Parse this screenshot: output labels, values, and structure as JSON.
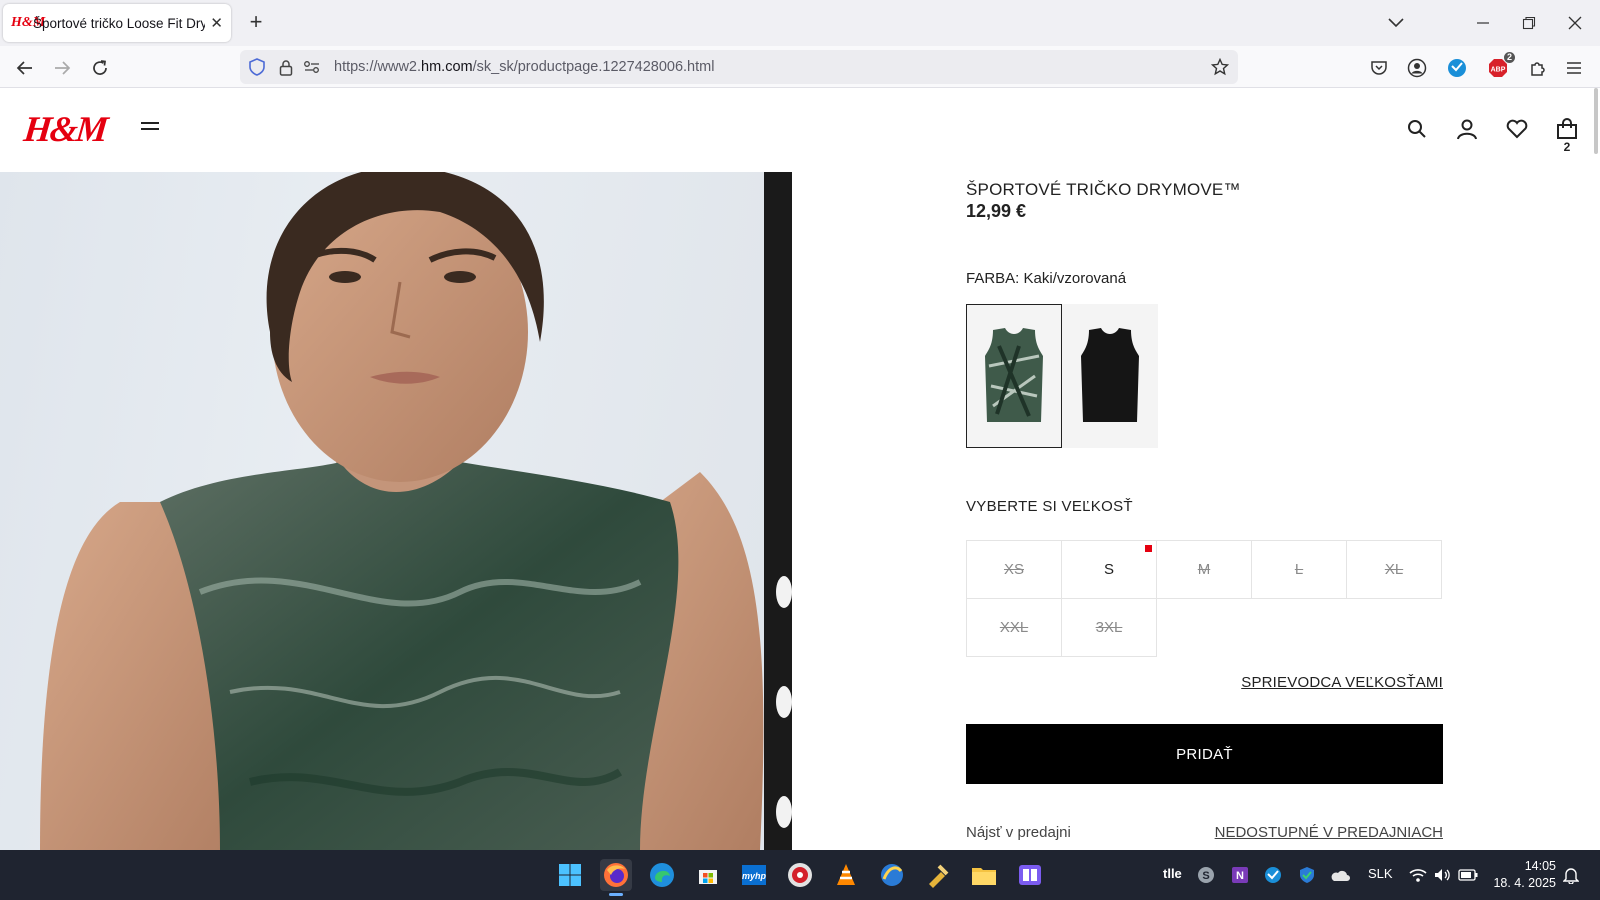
{
  "browser": {
    "tab_title": "Športové tričko Loose Fit DryMove™",
    "tab_favicon": "H&M",
    "url_prefix": "https://www2.",
    "url_domain": "hm.com",
    "url_path": "/sk_sk/productpage.1227428006.html",
    "extension_badge": "2"
  },
  "site": {
    "logo": "H&M",
    "cart_count": "2",
    "brand_color": "#e50010"
  },
  "product": {
    "title": "ŠPORTOVÉ TRIČKO DRYMOVE™",
    "price": "12,99 €",
    "color_label": "FARBA: Kaki/vzorovaná",
    "size_label": "VYBERTE SI VEĽKOSŤ",
    "sizes": [
      {
        "label": "XS",
        "available": false
      },
      {
        "label": "S",
        "available": true
      },
      {
        "label": "M",
        "available": false
      },
      {
        "label": "L",
        "available": false
      },
      {
        "label": "XL",
        "available": false
      },
      {
        "label": "XXL",
        "available": false
      },
      {
        "label": "3XL",
        "available": false
      }
    ],
    "size_guide": "SPRIEVODCA VEĽKOSŤAMI",
    "add_button": "PRIDAŤ",
    "store_label": "Nájsť v predajni",
    "store_status": "NEDOSTUPNÉ V PREDAJNIACH"
  },
  "taskbar": {
    "tray_text": "tlle",
    "language": "SLK",
    "time": "14:05",
    "date": "18. 4. 2025"
  }
}
